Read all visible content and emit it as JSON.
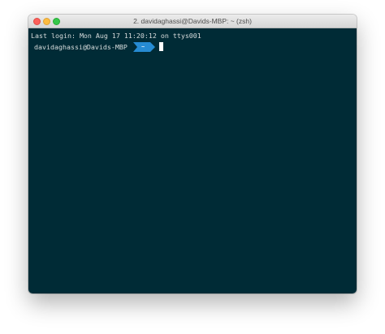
{
  "window": {
    "title": "2. davidaghassi@Davids-MBP: ~ (zsh)"
  },
  "terminal": {
    "last_login": "Last login: Mon Aug 17 11:20:12 on ttys001",
    "prompt_context": "davidaghassi@Davids-MBP",
    "prompt_dir": "~"
  },
  "colors": {
    "terminal_background": "#002b36",
    "prompt_segment": "#268bd2",
    "terminal_text": "#d7dcdc"
  },
  "icons": [
    "close-icon",
    "minimize-icon",
    "zoom-icon"
  ]
}
